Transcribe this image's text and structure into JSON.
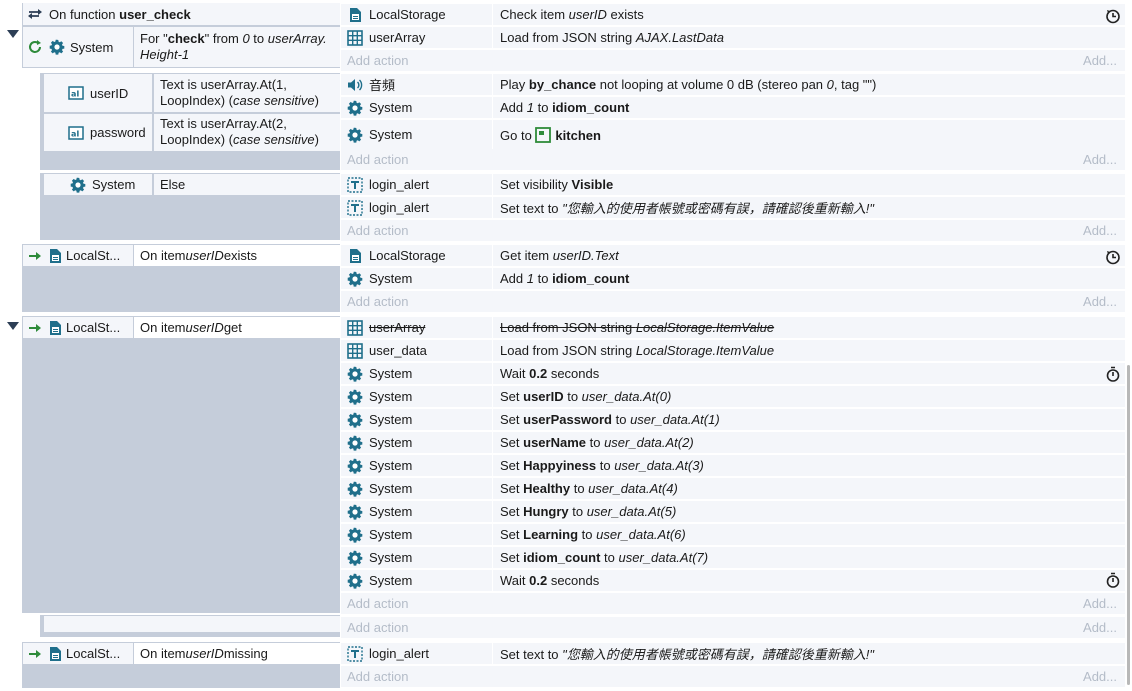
{
  "function_header": {
    "prefix": "On function",
    "name": "user_check"
  },
  "blocks": {
    "b0": {
      "conditions": [
        {
          "object": "System",
          "text_parts": [
            {
              "t": "For \"",
              "s": ""
            },
            {
              "t": "check",
              "s": "b"
            },
            {
              "t": "\" from ",
              "s": ""
            },
            {
              "t": "0",
              "s": "i"
            },
            {
              "t": " to ",
              "s": ""
            },
            {
              "t": "userArray.",
              "s": "i"
            }
          ],
          "line2": "Height-1"
        }
      ],
      "actions": [
        {
          "object": "LocalStorage",
          "icon": "localstorage-icon",
          "parts": [
            {
              "t": "Check item ",
              "s": ""
            },
            {
              "t": "userID",
              "s": "i"
            },
            {
              "t": " exists",
              "s": ""
            }
          ]
        },
        {
          "object": "userArray",
          "icon": "array-icon",
          "parts": [
            {
              "t": "Load from JSON string ",
              "s": ""
            },
            {
              "t": "AJAX.LastData",
              "s": "i"
            }
          ]
        }
      ]
    },
    "b1": {
      "conditions": [
        {
          "object": "userID",
          "line1": "Text is userArray.At(1,",
          "line2a": "LoopIndex) (",
          "line2b": "case sensitive",
          "line2c": ")"
        },
        {
          "object": "password",
          "line1": "Text is userArray.At(2,",
          "line2a": "LoopIndex) (",
          "line2b": "case sensitive",
          "line2c": ")"
        }
      ],
      "actions": [
        {
          "object": "音頻",
          "icon": "audio-icon",
          "parts": [
            {
              "t": "Play ",
              "s": ""
            },
            {
              "t": "by_chance",
              "s": "b"
            },
            {
              "t": " not looping at volume 0 dB (stereo pan ",
              "s": ""
            },
            {
              "t": "0",
              "s": "i"
            },
            {
              "t": ", tag  \"\")",
              "s": ""
            }
          ]
        },
        {
          "object": "System",
          "icon": "gear-icon",
          "parts": [
            {
              "t": "Add ",
              "s": ""
            },
            {
              "t": "1",
              "s": "i"
            },
            {
              "t": " to ",
              "s": ""
            },
            {
              "t": "idiom_count",
              "s": "b"
            }
          ]
        },
        {
          "object": "System",
          "icon": "gear-icon",
          "parts": [
            {
              "t": "Go to ",
              "s": ""
            },
            {
              "t": "kitchen",
              "s": "b"
            }
          ]
        }
      ]
    },
    "b2": {
      "conditions": [
        {
          "object": "System",
          "text": "Else"
        }
      ],
      "actions": [
        {
          "object": "login_alert",
          "icon": "text-object-icon",
          "parts": [
            {
              "t": "Set visibility ",
              "s": ""
            },
            {
              "t": "Visible",
              "s": "b"
            }
          ]
        },
        {
          "object": "login_alert",
          "icon": "text-object-icon",
          "parts": [
            {
              "t": "Set text to ",
              "s": ""
            },
            {
              "t": "\"您輸入的使用者帳號或密碼有誤，請確認後重新輸入!\"",
              "s": "i"
            }
          ]
        }
      ]
    },
    "b3": {
      "conditions": [
        {
          "object": "LocalSt...",
          "parts": [
            {
              "t": "On item ",
              "s": ""
            },
            {
              "t": "userID",
              "s": "i"
            },
            {
              "t": " exists",
              "s": ""
            }
          ]
        }
      ],
      "actions": [
        {
          "object": "LocalStorage",
          "icon": "localstorage-icon",
          "parts": [
            {
              "t": "Get item ",
              "s": ""
            },
            {
              "t": "userID.Text",
              "s": "i"
            }
          ]
        },
        {
          "object": "System",
          "icon": "gear-icon",
          "parts": [
            {
              "t": "Add ",
              "s": ""
            },
            {
              "t": "1",
              "s": "i"
            },
            {
              "t": " to ",
              "s": ""
            },
            {
              "t": "idiom_count",
              "s": "b"
            }
          ]
        }
      ]
    },
    "b4": {
      "conditions": [
        {
          "object": "LocalSt...",
          "parts": [
            {
              "t": "On item ",
              "s": ""
            },
            {
              "t": "userID",
              "s": "i"
            },
            {
              "t": " get",
              "s": ""
            }
          ]
        }
      ],
      "actions": [
        {
          "object": "userArray",
          "icon": "array-icon",
          "disabled": true,
          "parts": [
            {
              "t": "Load from JSON string ",
              "s": ""
            },
            {
              "t": "LocalStorage.ItemValue",
              "s": "i"
            }
          ]
        },
        {
          "object": "user_data",
          "icon": "array-icon",
          "parts": [
            {
              "t": "Load from JSON string ",
              "s": ""
            },
            {
              "t": "LocalStorage.ItemValue",
              "s": "i"
            }
          ]
        },
        {
          "object": "System",
          "icon": "gear-icon",
          "parts": [
            {
              "t": "Wait ",
              "s": ""
            },
            {
              "t": "0.2",
              "s": "b"
            },
            {
              "t": " seconds",
              "s": ""
            }
          ]
        },
        {
          "object": "System",
          "icon": "gear-icon",
          "parts": [
            {
              "t": "Set ",
              "s": ""
            },
            {
              "t": "userID",
              "s": "b"
            },
            {
              "t": " to ",
              "s": ""
            },
            {
              "t": "user_data.At(0)",
              "s": "i"
            }
          ]
        },
        {
          "object": "System",
          "icon": "gear-icon",
          "parts": [
            {
              "t": "Set ",
              "s": ""
            },
            {
              "t": "userPassword",
              "s": "b"
            },
            {
              "t": " to ",
              "s": ""
            },
            {
              "t": "user_data.At(1)",
              "s": "i"
            }
          ]
        },
        {
          "object": "System",
          "icon": "gear-icon",
          "parts": [
            {
              "t": "Set ",
              "s": ""
            },
            {
              "t": "userName",
              "s": "b"
            },
            {
              "t": " to ",
              "s": ""
            },
            {
              "t": "user_data.At(2)",
              "s": "i"
            }
          ]
        },
        {
          "object": "System",
          "icon": "gear-icon",
          "parts": [
            {
              "t": "Set ",
              "s": ""
            },
            {
              "t": "Happyiness",
              "s": "b"
            },
            {
              "t": " to ",
              "s": ""
            },
            {
              "t": "user_data.At(3)",
              "s": "i"
            }
          ]
        },
        {
          "object": "System",
          "icon": "gear-icon",
          "parts": [
            {
              "t": "Set ",
              "s": ""
            },
            {
              "t": "Healthy",
              "s": "b"
            },
            {
              "t": " to ",
              "s": ""
            },
            {
              "t": "user_data.At(4)",
              "s": "i"
            }
          ]
        },
        {
          "object": "System",
          "icon": "gear-icon",
          "parts": [
            {
              "t": "Set ",
              "s": ""
            },
            {
              "t": "Hungry",
              "s": "b"
            },
            {
              "t": " to ",
              "s": ""
            },
            {
              "t": "user_data.At(5)",
              "s": "i"
            }
          ]
        },
        {
          "object": "System",
          "icon": "gear-icon",
          "parts": [
            {
              "t": "Set ",
              "s": ""
            },
            {
              "t": "Learning",
              "s": "b"
            },
            {
              "t": " to ",
              "s": ""
            },
            {
              "t": "user_data.At(6)",
              "s": "i"
            }
          ]
        },
        {
          "object": "System",
          "icon": "gear-icon",
          "parts": [
            {
              "t": "Set ",
              "s": ""
            },
            {
              "t": "idiom_count",
              "s": "b"
            },
            {
              "t": " to ",
              "s": ""
            },
            {
              "t": "user_data.At(7)",
              "s": "i"
            }
          ]
        },
        {
          "object": "System",
          "icon": "gear-icon",
          "parts": [
            {
              "t": "Wait ",
              "s": ""
            },
            {
              "t": "0.2",
              "s": "b"
            },
            {
              "t": " seconds",
              "s": ""
            }
          ]
        }
      ]
    },
    "b6": {
      "conditions": [
        {
          "object": "LocalSt...",
          "parts": [
            {
              "t": "On item ",
              "s": ""
            },
            {
              "t": "userID",
              "s": "i"
            },
            {
              "t": " missing",
              "s": ""
            }
          ]
        }
      ],
      "actions": [
        {
          "object": "login_alert",
          "icon": "text-object-icon",
          "parts": [
            {
              "t": "Set text to ",
              "s": ""
            },
            {
              "t": "\"您輸入的使用者帳號或密碼有誤，請確認後重新輸入!\"",
              "s": "i"
            }
          ]
        }
      ]
    }
  },
  "labels": {
    "add_action": "Add action",
    "add_right": "Add..."
  },
  "colors": {
    "accent": "#1f6f8b",
    "panel": "#c5cdda",
    "row": "#f4f6fa",
    "trigger_arrow": "#2e8b3a",
    "muted": "#b4bcc8"
  }
}
